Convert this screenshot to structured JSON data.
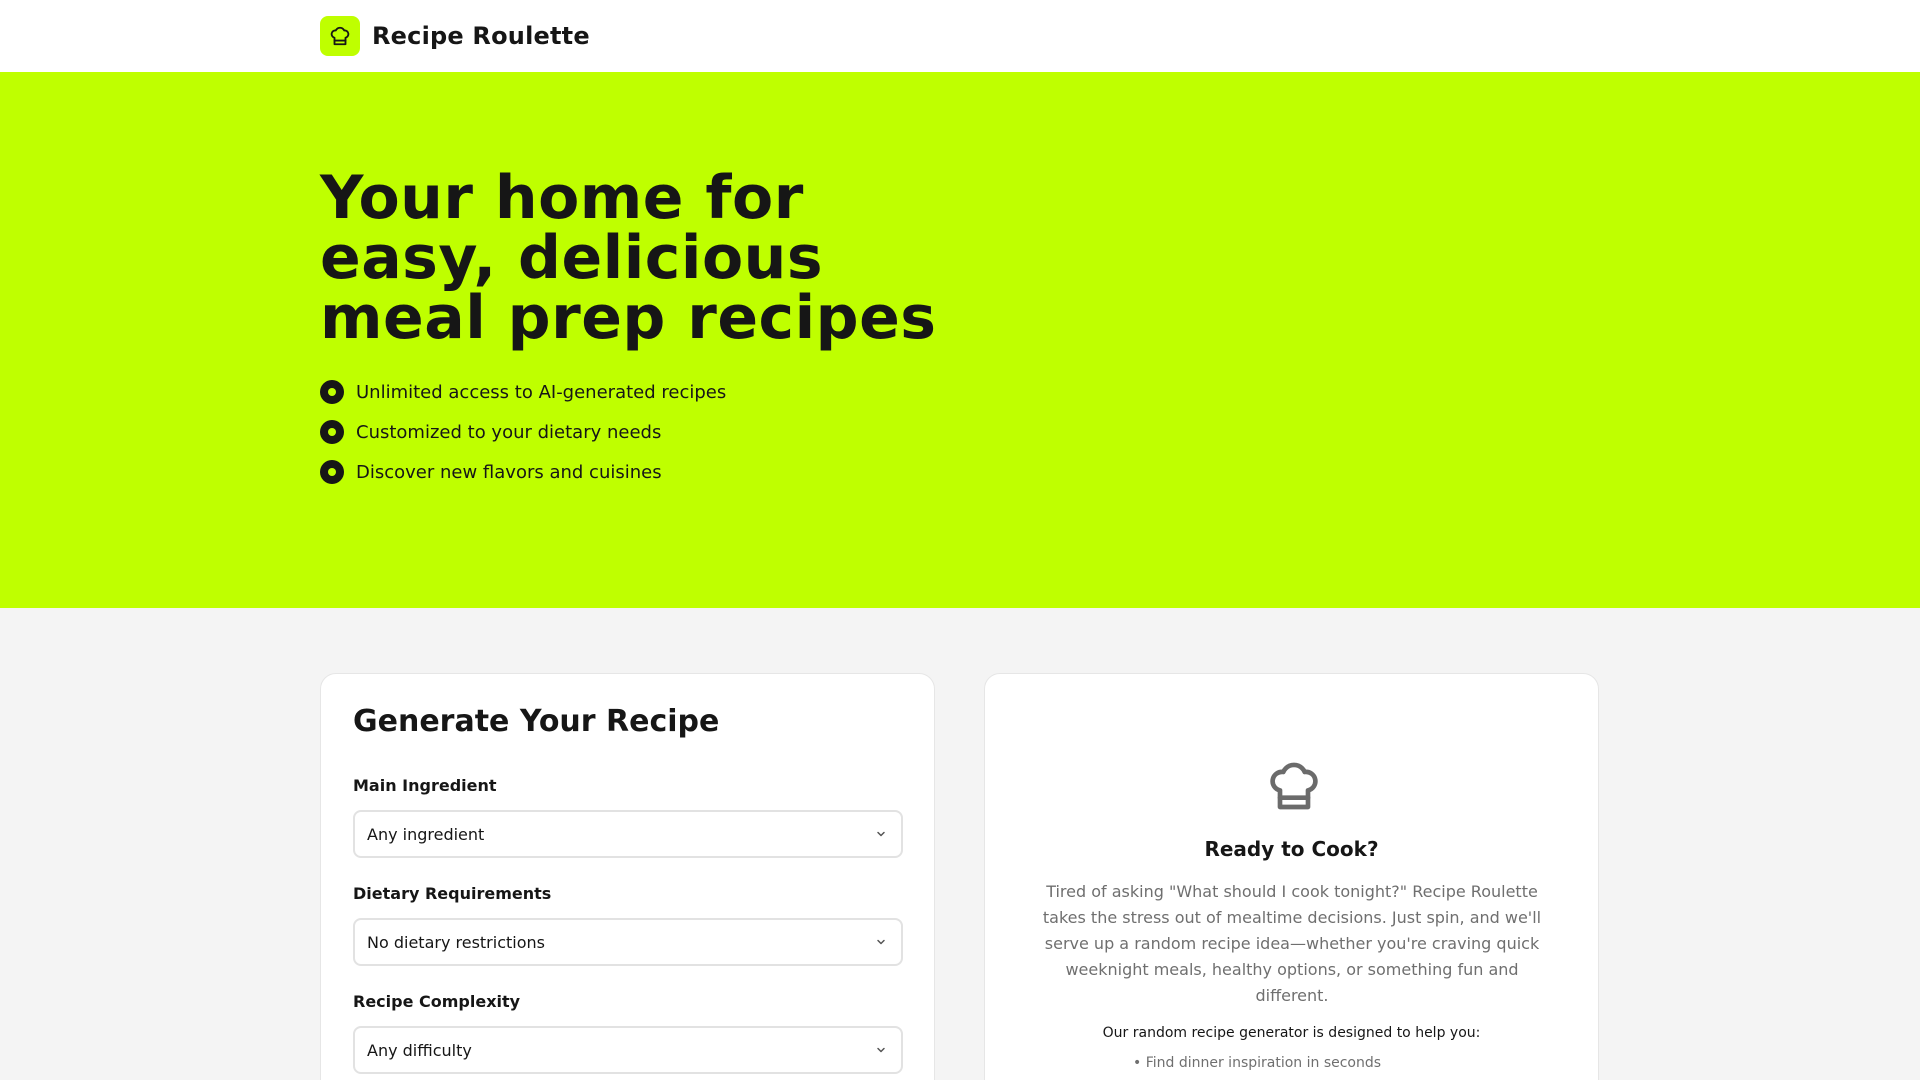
{
  "header": {
    "brand_name": "Recipe Roulette",
    "logo_icon": "chef-hat-icon"
  },
  "hero": {
    "title_lines": [
      "Your home for",
      "easy, delicious",
      "meal prep recipes"
    ],
    "features": [
      "Unlimited access to AI-generated recipes",
      "Customized to your dietary needs",
      "Discover new flavors and cuisines"
    ]
  },
  "form": {
    "title": "Generate Your Recipe",
    "fields": [
      {
        "label": "Main Ingredient",
        "value": "Any ingredient"
      },
      {
        "label": "Dietary Requirements",
        "value": "No dietary restrictions"
      },
      {
        "label": "Recipe Complexity",
        "value": "Any difficulty"
      }
    ]
  },
  "ready": {
    "icon": "chef-hat-icon",
    "title": "Ready to Cook?",
    "description": "Tired of asking \"What should I cook tonight?\" Recipe Roulette takes the stress out of mealtime decisions. Just spin, and we'll serve up a random recipe idea—whether you're craving quick weeknight meals, healthy options, or something fun and different.",
    "subheading": "Our random recipe generator is designed to help you:",
    "benefits": [
      "• Find dinner inspiration in seconds"
    ]
  },
  "colors": {
    "accent": "#bfff00",
    "text": "#161616",
    "muted": "#6f6f6f",
    "page_background": "#f4f4f4"
  }
}
